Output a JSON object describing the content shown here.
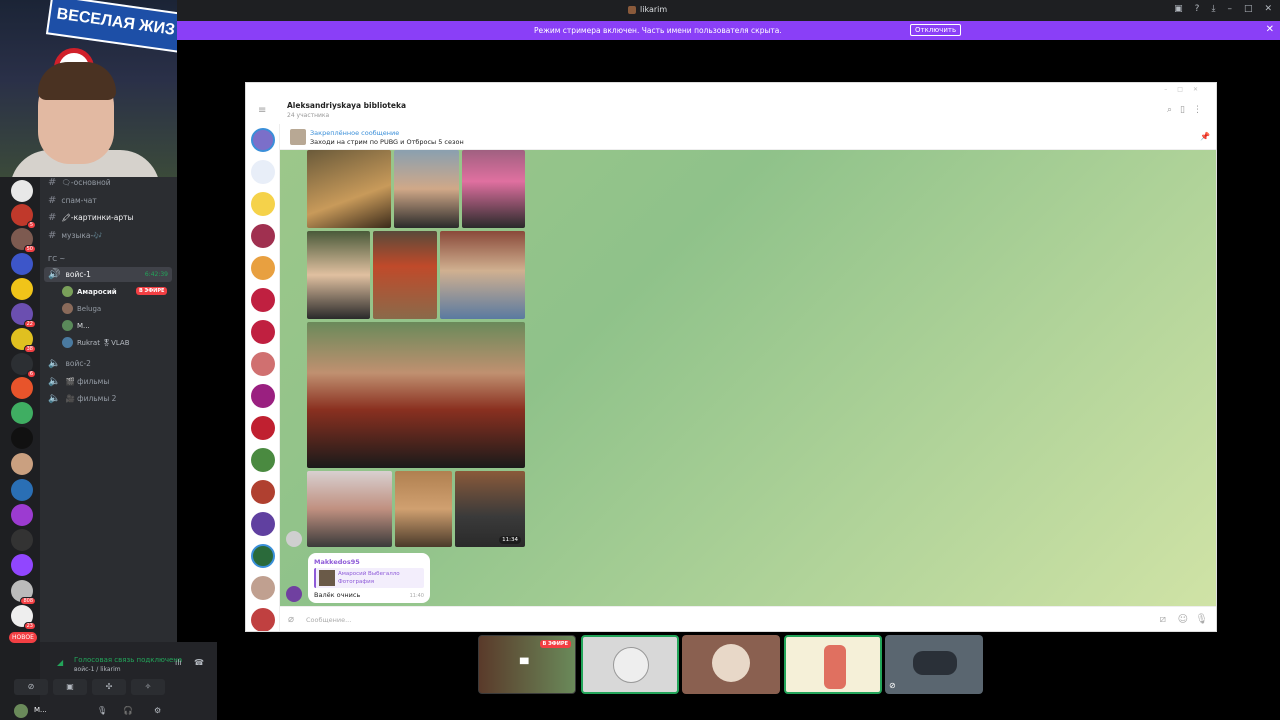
{
  "window": {
    "title": "likarim",
    "icons": [
      "monitor-icon",
      "help-icon",
      "download-icon",
      "minimize-icon",
      "maximize-icon",
      "close-icon"
    ]
  },
  "streamer_bar": {
    "message": "Режим стримера включен. Часть имени пользователя скрыта.",
    "button_label": "Отключить"
  },
  "webcam": {
    "sign_text": "ВЕСЕЛАЯ ЖИЗ"
  },
  "servers": {
    "badges": [
      "5",
      "50",
      "22",
      "38",
      "6",
      "808",
      "23"
    ],
    "new_label": "НОВОЕ"
  },
  "channels": {
    "text": [
      {
        "name": "🗨-основной"
      },
      {
        "name": "спам-чат"
      },
      {
        "name": "🖍-картинки-арты"
      },
      {
        "name": "музыка-🎶"
      }
    ],
    "category": "ГС ~",
    "voice_active": {
      "name": "войс-1",
      "timer": "6:42:39"
    },
    "voice_users": [
      {
        "name": "Амаросий",
        "live": "В ЭФИРЕ"
      },
      {
        "name": "Beluga"
      },
      {
        "name": "M..."
      },
      {
        "name": "Rukrat 🎖VLAB"
      }
    ],
    "voice_other": [
      {
        "name": "войс-2"
      },
      {
        "name": "🎬 фильмы"
      },
      {
        "name": "🎥 фильмы 2"
      }
    ]
  },
  "voice_panel": {
    "status": "Голосовая связь подключена",
    "sub": "войс-1 / likarim",
    "user": "M..."
  },
  "telegram": {
    "chat_title": "Aleksandriyskaya biblioteka",
    "chat_sub": "24 участника",
    "pinned_label": "Закреплённое сообщение",
    "pinned_text": "Заходи на стрим по PUBG и Отбросы 5 сезон",
    "photo_time": "11:34",
    "message": {
      "author": "Makkedos95",
      "reply_text": "Амаросий Выбегалло Фотография",
      "body": "Валёк очнись",
      "time": "11:40"
    },
    "input_placeholder": "Сообщение..."
  },
  "tiles": {
    "live_label": "В ЭФИРЕ"
  },
  "colors": {
    "accent": "#8a3ff7",
    "live": "#f23f43",
    "online": "#23a55a"
  }
}
